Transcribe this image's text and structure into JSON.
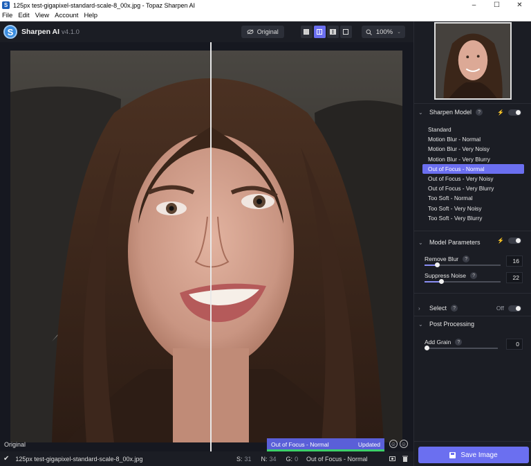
{
  "window": {
    "title": "125px test-gigapixel-standard-scale-8_00x.jpg - Topaz Sharpen AI",
    "app_icon": "S",
    "controls": [
      "–",
      "☐",
      "✕"
    ]
  },
  "menu": [
    "File",
    "Edit",
    "View",
    "Account",
    "Help"
  ],
  "header": {
    "app_name": "Sharpen AI",
    "version": "v4.1.0",
    "original_label": "Original",
    "zoom_value": "100%"
  },
  "canvas": {
    "original_label": "Original",
    "status_model": "Out of Focus - Normal",
    "status_state": "Updated"
  },
  "filebar": {
    "filename": "125px test-gigapixel-standard-scale-8_00x.jpg",
    "stats": [
      {
        "key": "S:",
        "value": "31"
      },
      {
        "key": "N:",
        "value": "34"
      },
      {
        "key": "G:",
        "value": "0"
      }
    ],
    "model": "Out of Focus - Normal"
  },
  "panel": {
    "sharpen_model": {
      "title": "Sharpen Model",
      "help": "?",
      "models": [
        "Standard",
        "Motion Blur - Normal",
        "Motion Blur - Very Noisy",
        "Motion Blur - Very Blurry",
        "Out of Focus - Normal",
        "Out of Focus - Very Noisy",
        "Out of Focus - Very Blurry",
        "Too Soft - Normal",
        "Too Soft - Very Noisy",
        "Too Soft - Very Blurry"
      ],
      "selected_index": 4
    },
    "model_parameters": {
      "title": "Model Parameters",
      "help": "?",
      "params": [
        {
          "label": "Remove Blur",
          "help": "?",
          "value": "16",
          "fraction": 0.16
        },
        {
          "label": "Suppress Noise",
          "help": "?",
          "value": "22",
          "fraction": 0.22
        }
      ]
    },
    "select": {
      "title": "Select",
      "help": "?",
      "state": "Off"
    },
    "post_processing": {
      "title": "Post Processing",
      "params": [
        {
          "label": "Add Grain",
          "help": "?",
          "value": "0",
          "fraction": 0.0
        }
      ]
    },
    "save_label": "Save Image"
  }
}
